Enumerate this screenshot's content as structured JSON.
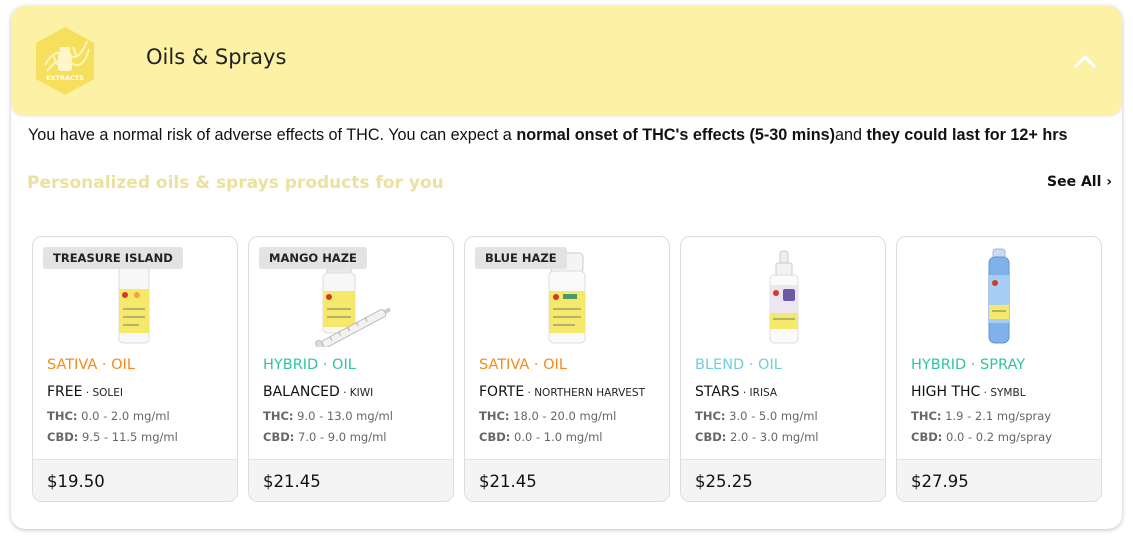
{
  "header": {
    "badge_label": "EXTRACTS",
    "title": "Oils & Sprays",
    "colors": {
      "header_bg": "#fcf1a4",
      "badge_fill": "#f6df5c"
    }
  },
  "description": {
    "part1": "You have a normal risk of adverse effects of THC. You can expect a ",
    "bold1": "normal onset of THC's effects (5-30 mins)",
    "part2": "and ",
    "bold2": "they could last for 12+ hrs"
  },
  "section": {
    "title": "Personalized oils & sprays products for you",
    "see_all": "See All ›"
  },
  "products": [
    {
      "strain": "TREASURE ISLAND",
      "category": "SATIVA · OIL",
      "category_color": "#f28a1e",
      "name": "FREE",
      "brand": " · SOLEI",
      "thc_label": "THC:",
      "thc": " 0.0 - 2.0 mg/ml",
      "cbd_label": "CBD:",
      "cbd": " 9.5 - 11.5 mg/ml",
      "price": "$19.50",
      "image": "small-bottle-icon"
    },
    {
      "strain": "MANGO HAZE",
      "category": "HYBRID · OIL",
      "category_color": "#2ec4a4",
      "name": "BALANCED",
      "brand": " · KIWI",
      "thc_label": "THC:",
      "thc": " 9.0 - 13.0 mg/ml",
      "cbd_label": "CBD:",
      "cbd": " 7.0 - 9.0 mg/ml",
      "price": "$21.45",
      "image": "bottle-with-syringe-icon"
    },
    {
      "strain": "BLUE HAZE",
      "category": "SATIVA · OIL",
      "category_color": "#f28a1e",
      "name": "FORTE",
      "brand": " · NORTHERN HARVEST",
      "thc_label": "THC:",
      "thc": " 18.0 - 20.0 mg/ml",
      "cbd_label": "CBD:",
      "cbd": " 0.0 - 1.0 mg/ml",
      "price": "$21.45",
      "image": "white-bottle-icon"
    },
    {
      "strain": "",
      "category": "BLEND · OIL",
      "category_color": "#6fd0dc",
      "name": "STARS",
      "brand": " · IRISA",
      "thc_label": "THC:",
      "thc": " 3.0 - 5.0 mg/ml",
      "cbd_label": "CBD:",
      "cbd": " 2.0 - 3.0 mg/ml",
      "price": "$25.25",
      "image": "dropper-bottle-icon"
    },
    {
      "strain": "",
      "category": "HYBRID · SPRAY",
      "category_color": "#2ec4a4",
      "name": "HIGH THC",
      "brand": " · SYMBL",
      "thc_label": "THC:",
      "thc": " 1.9 - 2.1 mg/spray",
      "cbd_label": "CBD:",
      "cbd": " 0.0 - 0.2 mg/spray",
      "price": "$27.95",
      "image": "spray-bottle-icon"
    }
  ]
}
